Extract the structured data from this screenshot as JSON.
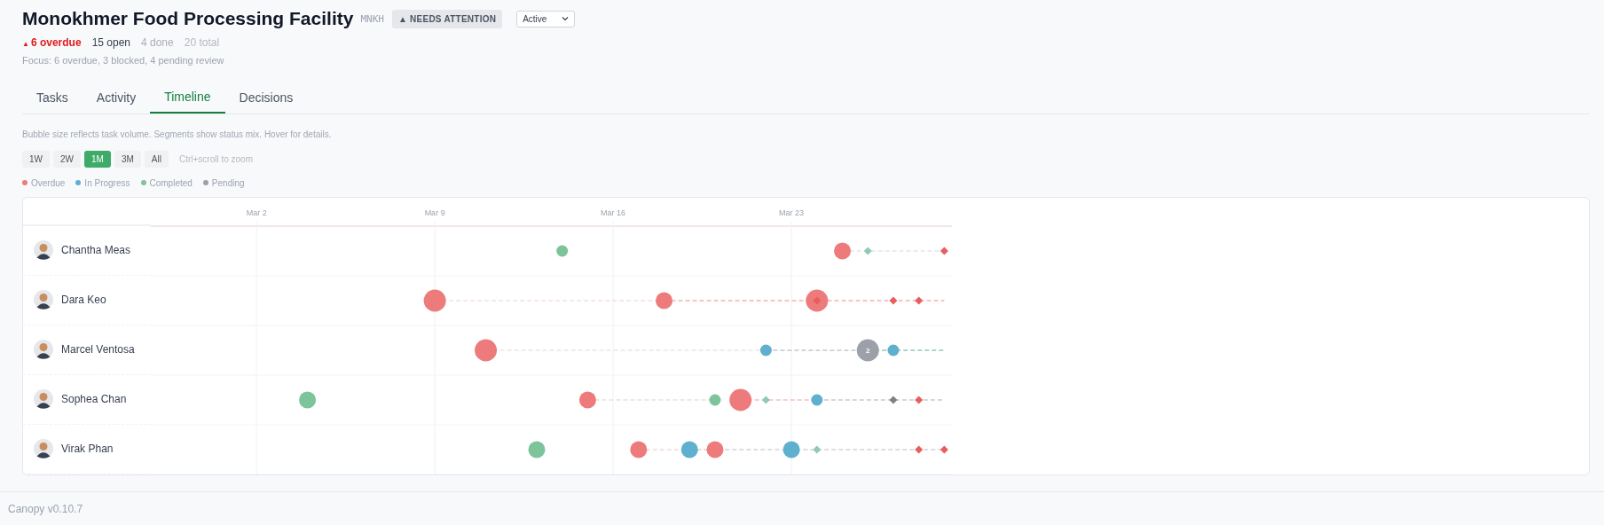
{
  "header": {
    "title": "Monokhmer Food Processing Facility",
    "code": "MNKH",
    "badge": "▲ NEEDS ATTENTION",
    "status_select": {
      "value": "Active"
    },
    "stats": [
      {
        "kind": "overdue",
        "marker": "▲",
        "text": "6 overdue"
      },
      {
        "kind": "open",
        "text": "15 open"
      },
      {
        "kind": "done",
        "text": "4 done"
      },
      {
        "kind": "total",
        "text": "20 total"
      }
    ],
    "focus": "Focus: 6 overdue, 3 blocked, 4 pending review"
  },
  "tabs": [
    {
      "label": "Tasks",
      "selected": false
    },
    {
      "label": "Activity",
      "selected": false
    },
    {
      "label": "Timeline",
      "selected": true
    },
    {
      "label": "Decisions",
      "selected": false
    }
  ],
  "timeline": {
    "hint": "Bubble size reflects task volume. Segments show status mix. Hover for details.",
    "ranges": [
      {
        "label": "1W",
        "selected": false
      },
      {
        "label": "2W",
        "selected": false
      },
      {
        "label": "1M",
        "selected": true
      },
      {
        "label": "3M",
        "selected": false
      },
      {
        "label": "All",
        "selected": false
      }
    ],
    "zoom_hint": "Ctrl+scroll to zoom",
    "legend": [
      {
        "label": "Overdue",
        "color": "#ee7b7b"
      },
      {
        "label": "In Progress",
        "color": "#5fb0cf"
      },
      {
        "label": "Completed",
        "color": "#7ec49b"
      },
      {
        "label": "Pending",
        "color": "#9ca0a8"
      }
    ],
    "date_labels": [
      "Mar 2",
      "Mar 9",
      "Mar 16",
      "Mar 23"
    ],
    "people": [
      {
        "name": "Chantha Meas"
      },
      {
        "name": "Dara Keo"
      },
      {
        "name": "Marcel Ventosa"
      },
      {
        "name": "Sophea Chan"
      },
      {
        "name": "Virak Phan"
      }
    ],
    "bubble_count": "2"
  },
  "footer": {
    "version": "Canopy v0.10.7"
  }
}
